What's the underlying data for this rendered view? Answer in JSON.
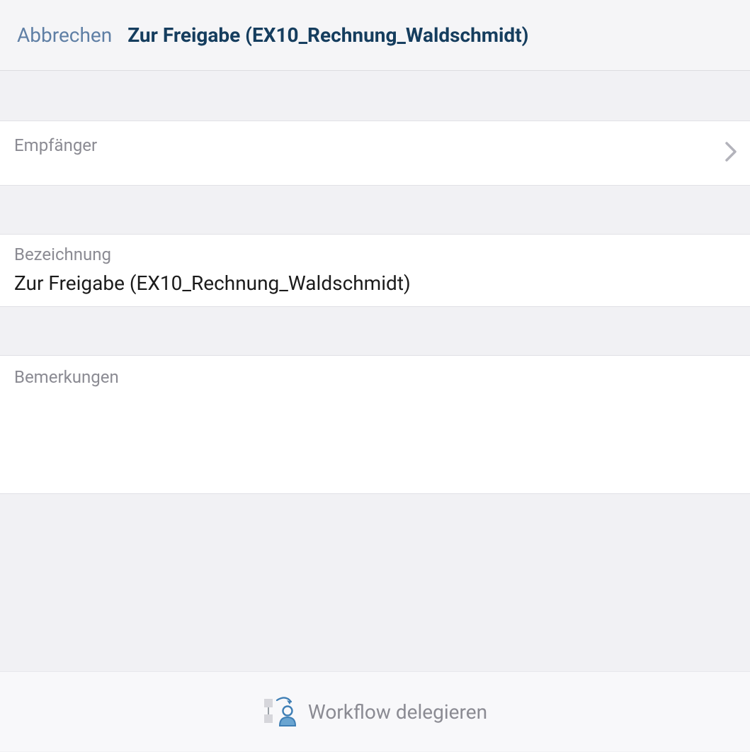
{
  "header": {
    "cancel": "Abbrechen",
    "title": "Zur Freigabe (EX10_Rechnung_Waldschmidt)"
  },
  "fields": {
    "recipient_label": "Empfänger",
    "description_label": "Bezeichnung",
    "description_value": "Zur Freigabe (EX10_Rechnung_Waldschmidt)",
    "remarks_label": "Bemerkungen",
    "remarks_value": ""
  },
  "footer": {
    "action_label": "Workflow delegieren"
  }
}
